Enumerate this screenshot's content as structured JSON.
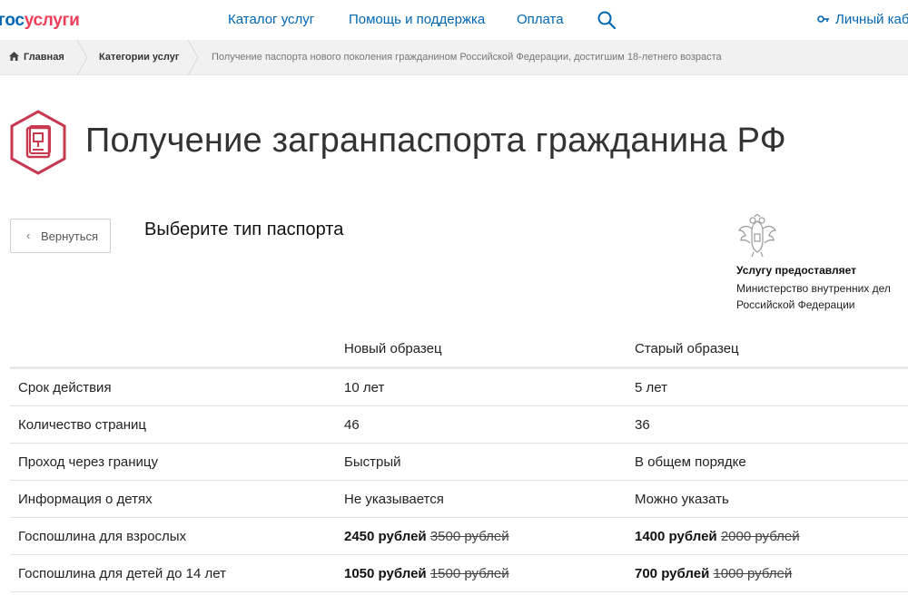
{
  "header": {
    "logo": {
      "part1": "гос",
      "part2": "услуги"
    },
    "nav": [
      "Каталог услуг",
      "Помощь и поддержка",
      "Оплата"
    ],
    "search_icon": "search-icon",
    "account_label": "Личный каби"
  },
  "breadcrumbs": {
    "home": "Главная",
    "categories": "Категории услуг",
    "current": "Получение паспорта нового поколения гражданином Российской Федерации, достигшим 18-летнего возраста"
  },
  "page": {
    "title": "Получение загранпаспорта гражданина РФ",
    "back_label": "Вернуться",
    "subtitle": "Выберите тип паспорта"
  },
  "provider": {
    "label": "Услугу предоставляет",
    "name": "Министерство внутренних дел Российской Федерации"
  },
  "table": {
    "columns": [
      "",
      "Новый образец",
      "Старый образец"
    ],
    "rows": [
      {
        "label": "Срок действия",
        "new": "10 лет",
        "old": "5 лет"
      },
      {
        "label": "Количество страниц",
        "new": "46",
        "old": "36"
      },
      {
        "label": "Проход через границу",
        "new": "Быстрый",
        "old": "В общем порядке"
      },
      {
        "label": "Информация о детях",
        "new": "Не указывается",
        "old": "Можно указать"
      },
      {
        "label": "Госпошлина для взрослых",
        "new_price": "2450 рублей",
        "new_old_price": "3500 рублей",
        "old_price": "1400 рублей",
        "old_old_price": "2000 рублей"
      },
      {
        "label": "Госпошлина для детей до 14 лет",
        "new_price": "1050 рублей",
        "new_old_price": "1500 рублей",
        "old_price": "700 рублей",
        "old_old_price": "1000 рублей"
      }
    ]
  },
  "colors": {
    "brand_blue": "#0066b3",
    "brand_red": "#ee3f58",
    "icon_red": "#c8384e"
  }
}
